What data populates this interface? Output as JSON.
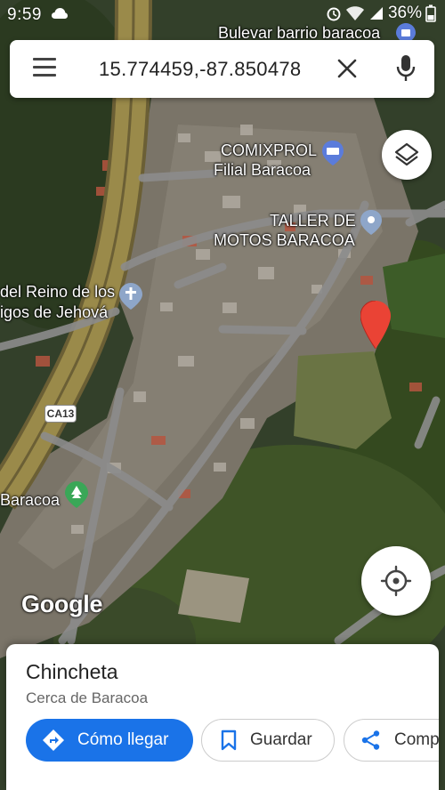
{
  "status_bar": {
    "time": "9:59",
    "battery": "36%"
  },
  "search": {
    "query": "15.774459,-87.850478"
  },
  "map": {
    "labels": {
      "bulevar": "Bulevar barrio baracoa",
      "comixprol_1": "COMIXPROL",
      "comixprol_2": "Filial Baracoa",
      "taller_1": "TALLER DE",
      "taller_2": "MOTOS BARACOA",
      "reino_1": "del Reino de los",
      "reino_2": "igos de Jehová",
      "baracoa": "Baracoa"
    },
    "road_shield": "CA13",
    "logo": "Google"
  },
  "place": {
    "title": "Chincheta",
    "subtitle": "Cerca de Baracoa",
    "directions_label": "Cómo llegar",
    "save_label": "Guardar",
    "share_label": "Compartir"
  },
  "colors": {
    "accent": "#1a73e8",
    "pin": "#ea4335"
  }
}
